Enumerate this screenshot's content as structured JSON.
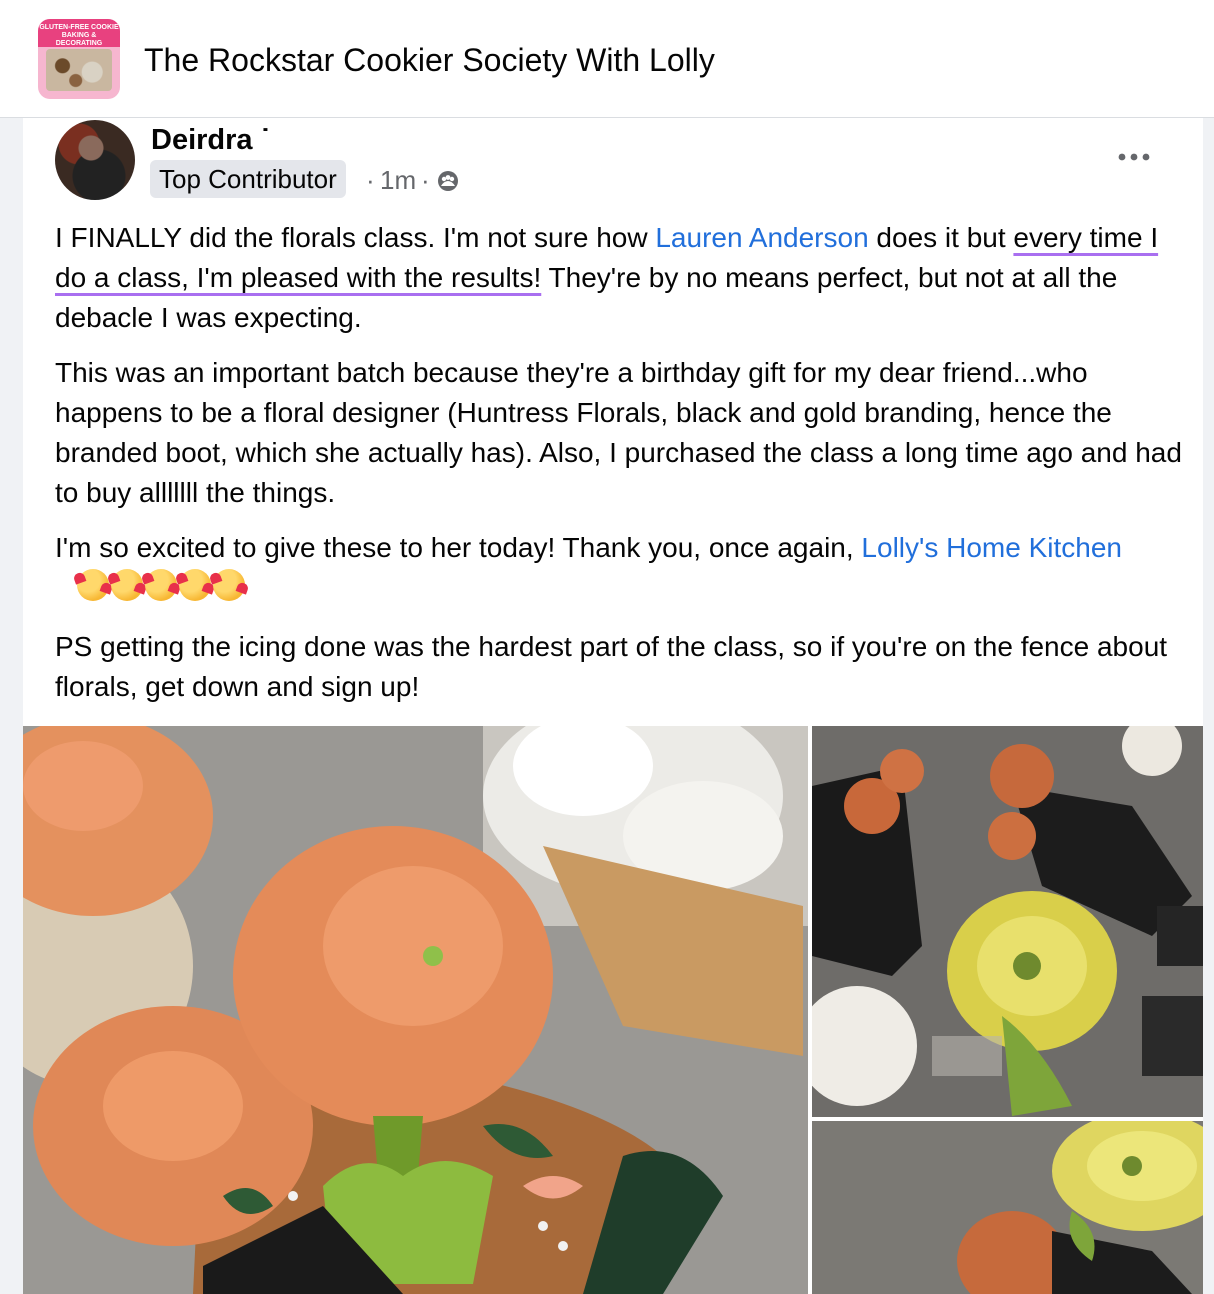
{
  "group": {
    "title": "The Rockstar Cookier Society With Lolly",
    "thumbnail_text": "GLUTEN-FREE COOKIE BAKING & DECORATING"
  },
  "post": {
    "author": "Deirdra ˙",
    "badge": "Top Contributor",
    "dot": "·",
    "time": "1m",
    "privacy_icon": "group-members-icon",
    "more_icon": "more-options-icon",
    "paragraphs": {
      "p1": {
        "a": "I FINALLY did the florals class. I'm not sure how ",
        "mention": "Lauren Anderson",
        "b": " does it but ",
        "highlight": "every time I do a class, I'm pleased with the results!",
        "c": " They're by no means perfect, but not at all the debacle I was expecting."
      },
      "p2": "This was an important batch because they're a birthday gift for my dear friend...who happens to be a floral designer (Huntress Florals, black and gold branding, hence the branded boot, which she actually has).  Also, I purchased the class a long time ago and had to buy alllllll the things.",
      "p3": {
        "a": "I'm so excited to give these to her today! Thank you, once again, ",
        "mention": "Lolly's Home Kitchen",
        "emoji_icon": "smiling-face-with-hearts-icon",
        "emoji_count": 5
      },
      "p4": "PS getting the icing done was the hardest part of the class, so if you're on the fence about florals, get down and sign up!"
    },
    "highlight_color": "#a96ff0",
    "mention_color": "#216fdb",
    "photos": [
      "photo-main",
      "photo-side-top",
      "photo-side-bottom"
    ]
  }
}
